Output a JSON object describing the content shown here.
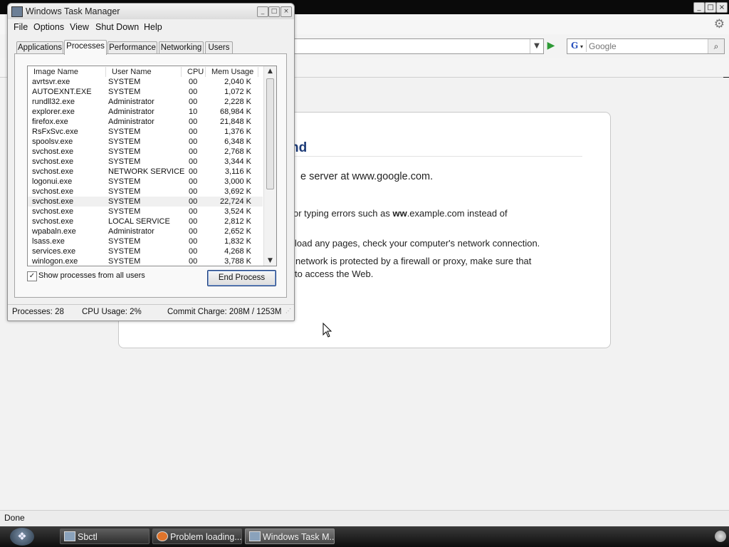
{
  "browser": {
    "search_placeholder": "Google",
    "search_engine_letter": "G",
    "error_title_fragment": "nd",
    "error_lines": [
      {
        "text": "e server at www.google.com."
      },
      {
        "pre": "or typing errors such as ",
        "bold": "ww",
        "post": ".example.com instead of"
      },
      {
        "text": "load any pages, check your computer's network connection."
      },
      {
        "text": "network is protected by a firewall or proxy, make sure that"
      },
      {
        "text": "to access the Web."
      }
    ],
    "status_text": "Done"
  },
  "taskbar": {
    "buttons": [
      {
        "label": "Sbctl"
      },
      {
        "label": "Problem loading..."
      },
      {
        "label": "Windows Task M..."
      }
    ]
  },
  "task_manager": {
    "title": "Windows Task Manager",
    "menu": [
      "File",
      "Options",
      "View",
      "Shut Down",
      "Help"
    ],
    "tabs": [
      "Applications",
      "Processes",
      "Performance",
      "Networking",
      "Users"
    ],
    "active_tab": "Processes",
    "columns": [
      "Image Name",
      "User Name",
      "CPU",
      "Mem Usage"
    ],
    "processes": [
      {
        "name": "avrtsvr.exe",
        "user": "SYSTEM",
        "cpu": "00",
        "mem": "2,040 K"
      },
      {
        "name": "AUTOEXNT.EXE",
        "user": "SYSTEM",
        "cpu": "00",
        "mem": "1,072 K"
      },
      {
        "name": "rundll32.exe",
        "user": "Administrator",
        "cpu": "00",
        "mem": "2,228 K"
      },
      {
        "name": "explorer.exe",
        "user": "Administrator",
        "cpu": "10",
        "mem": "68,984 K"
      },
      {
        "name": "firefox.exe",
        "user": "Administrator",
        "cpu": "00",
        "mem": "21,848 K"
      },
      {
        "name": "RsFxSvc.exe",
        "user": "SYSTEM",
        "cpu": "00",
        "mem": "1,376 K"
      },
      {
        "name": "spoolsv.exe",
        "user": "SYSTEM",
        "cpu": "00",
        "mem": "6,348 K"
      },
      {
        "name": "svchost.exe",
        "user": "SYSTEM",
        "cpu": "00",
        "mem": "2,768 K"
      },
      {
        "name": "svchost.exe",
        "user": "SYSTEM",
        "cpu": "00",
        "mem": "3,344 K"
      },
      {
        "name": "svchost.exe",
        "user": "NETWORK SERVICE",
        "cpu": "00",
        "mem": "3,116 K"
      },
      {
        "name": "logonui.exe",
        "user": "SYSTEM",
        "cpu": "00",
        "mem": "3,000 K"
      },
      {
        "name": "svchost.exe",
        "user": "SYSTEM",
        "cpu": "00",
        "mem": "3,692 K"
      },
      {
        "name": "svchost.exe",
        "user": "SYSTEM",
        "cpu": "00",
        "mem": "22,724 K",
        "highlighted": true
      },
      {
        "name": "svchost.exe",
        "user": "SYSTEM",
        "cpu": "00",
        "mem": "3,524 K"
      },
      {
        "name": "svchost.exe",
        "user": "LOCAL SERVICE",
        "cpu": "00",
        "mem": "2,812 K"
      },
      {
        "name": "wpabaln.exe",
        "user": "Administrator",
        "cpu": "00",
        "mem": "2,652 K"
      },
      {
        "name": "lsass.exe",
        "user": "SYSTEM",
        "cpu": "00",
        "mem": "1,832 K"
      },
      {
        "name": "services.exe",
        "user": "SYSTEM",
        "cpu": "00",
        "mem": "4,268 K"
      },
      {
        "name": "winlogon.exe",
        "user": "SYSTEM",
        "cpu": "00",
        "mem": "3,788 K"
      }
    ],
    "show_all_users_label": "Show processes from all users",
    "show_all_users_checked": true,
    "end_process_label": "End Process",
    "status": {
      "processes": "Processes: 28",
      "cpu": "CPU Usage: 2%",
      "commit": "Commit Charge: 208M / 1253M"
    }
  },
  "colors": {
    "accent_green": "#2e9a36",
    "error_title": "#1d3b78"
  }
}
